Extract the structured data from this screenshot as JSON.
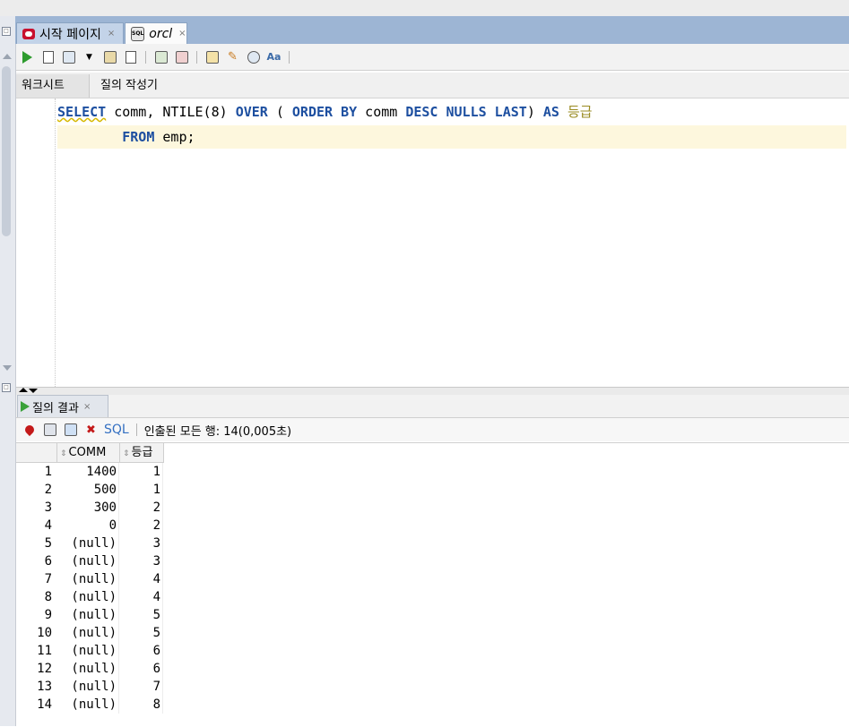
{
  "tabs": [
    {
      "label": "시작 페이지",
      "close": "×"
    },
    {
      "label": "orcl",
      "close": "×"
    }
  ],
  "worksheet_tabs": [
    "워크시트",
    "질의 작성기"
  ],
  "code": {
    "line1": {
      "select": "SELECT",
      "comm": " comm, ",
      "ntile": "NTILE(",
      "eight": "8",
      "close": ") ",
      "over": "OVER",
      "paren": " ( ",
      "orderby": "ORDER BY",
      "comm2": " comm ",
      "desc": "DESC",
      "space": " ",
      "nulls": "NULLS LAST",
      "close2": ") ",
      "as": "AS",
      "space2": " ",
      "alias": "등급"
    },
    "line2": {
      "indent": "        ",
      "from": "FROM",
      "rest": " emp;"
    }
  },
  "result": {
    "tab_label": "질의 결과",
    "tab_close": "×",
    "sql_label": "SQL",
    "status": "인출된 모든 행: 14(0,005초)",
    "columns": [
      "COMM",
      "등급"
    ],
    "rows": [
      {
        "n": "1",
        "comm": "1400",
        "grade": "1"
      },
      {
        "n": "2",
        "comm": "500",
        "grade": "1"
      },
      {
        "n": "3",
        "comm": "300",
        "grade": "2"
      },
      {
        "n": "4",
        "comm": "0",
        "grade": "2"
      },
      {
        "n": "5",
        "comm": "(null)",
        "grade": "3"
      },
      {
        "n": "6",
        "comm": "(null)",
        "grade": "3"
      },
      {
        "n": "7",
        "comm": "(null)",
        "grade": "4"
      },
      {
        "n": "8",
        "comm": "(null)",
        "grade": "4"
      },
      {
        "n": "9",
        "comm": "(null)",
        "grade": "5"
      },
      {
        "n": "10",
        "comm": "(null)",
        "grade": "5"
      },
      {
        "n": "11",
        "comm": "(null)",
        "grade": "6"
      },
      {
        "n": "12",
        "comm": "(null)",
        "grade": "6"
      },
      {
        "n": "13",
        "comm": "(null)",
        "grade": "7"
      },
      {
        "n": "14",
        "comm": "(null)",
        "grade": "8"
      }
    ]
  },
  "colors": {
    "tab_bar": "#9db5d4",
    "keyword": "#1d4fa0",
    "alias": "#9a8b21",
    "current_line": "#fdf7dd"
  }
}
